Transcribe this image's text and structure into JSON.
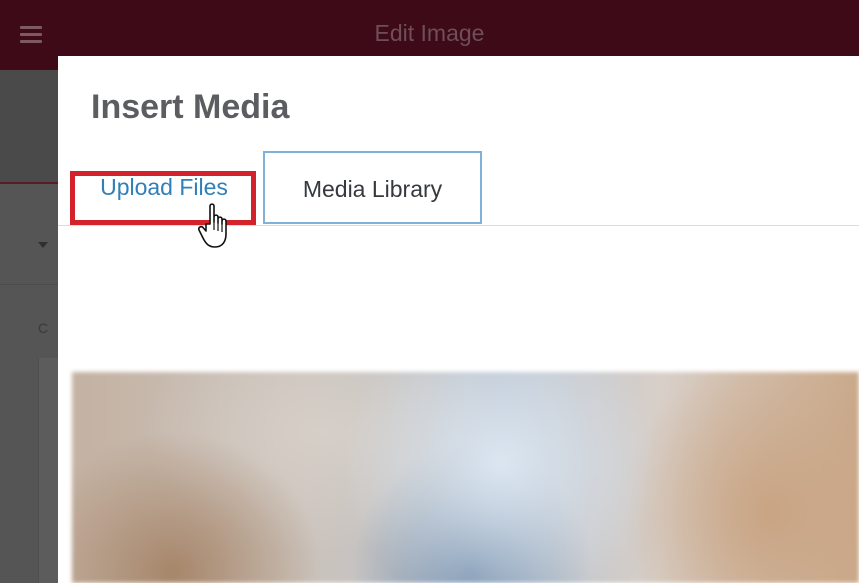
{
  "topbar": {
    "title": "Edit Image",
    "menu_icon": "hamburger-icon"
  },
  "sidebar": {
    "letter": "C",
    "caret_icon": "caret-down-icon"
  },
  "modal": {
    "title": "Insert Media",
    "tabs": [
      {
        "label": "Upload Files",
        "state": "highlighted"
      },
      {
        "label": "Media Library",
        "state": "active"
      }
    ]
  },
  "annotation": {
    "highlight_color": "#d3222b",
    "cursor_icon": "hand-pointer-icon"
  },
  "colors": {
    "topbar_bg": "#3e0a17",
    "link_blue": "#2f7fb8",
    "active_tab_border": "#7fb1d9"
  }
}
